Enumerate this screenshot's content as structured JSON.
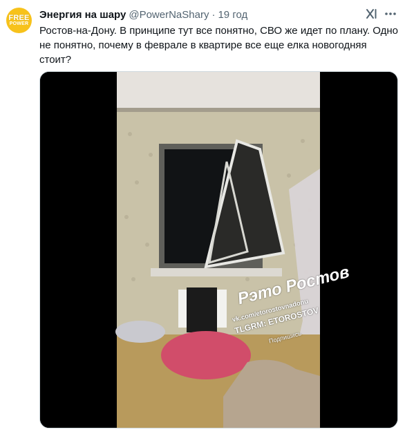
{
  "tweet": {
    "avatar": {
      "line1": "FREE",
      "line2": "POWER",
      "color": "#f7c21b"
    },
    "author_name": "Энергия на шару",
    "author_handle": "@PowerNaShary",
    "separator": "·",
    "time": "19 год",
    "text": "Ростов-на-Дону. В принципе тут все понятно, СВО же идет по плану. Одно не понятно, почему в феврале в квартире все еще елка новогодняя стоит?",
    "icons": {
      "grok": "grok-icon",
      "more": "more-icon"
    },
    "media": {
      "kind": "video",
      "watermark": {
        "title": "Рэто Ростов",
        "vk": "vk.com/etorostovnadonu",
        "telegram": "TLGRM: ETOROSTOV",
        "subscribe": "Подпишись"
      }
    }
  }
}
